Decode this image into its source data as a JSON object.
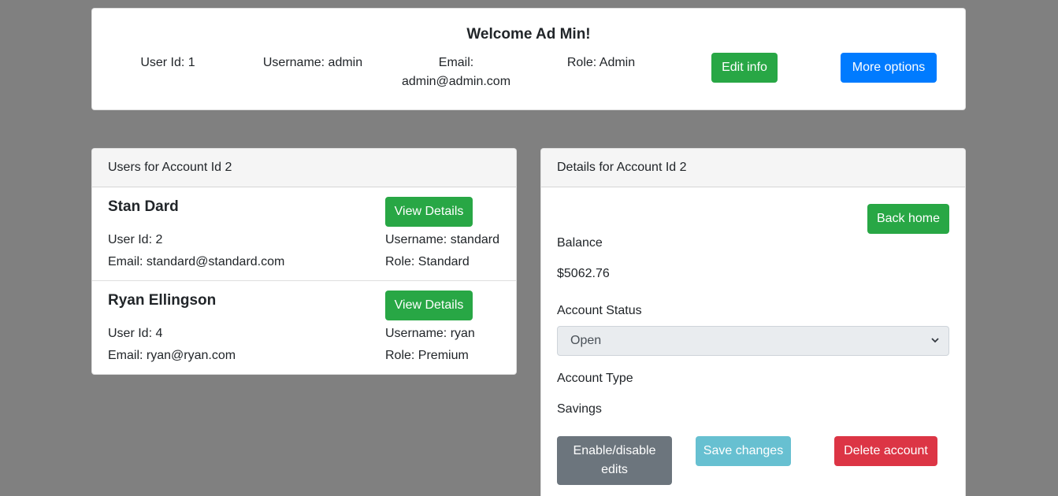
{
  "welcome": {
    "title": "Welcome Ad Min!",
    "user_id": "User Id: 1",
    "username": "Username: admin",
    "email_label": "Email:",
    "email_value": "admin@admin.com",
    "role": "Role: Admin",
    "edit_info_label": "Edit info",
    "more_options_label": "More options"
  },
  "users_panel": {
    "header": "Users for Account Id 2",
    "users": [
      {
        "name": "Stan Dard",
        "view_details_label": "View Details",
        "user_id": "User Id: 2",
        "username": "Username: standard",
        "email": "Email: standard@standard.com",
        "role": "Role: Standard"
      },
      {
        "name": "Ryan Ellingson",
        "view_details_label": "View Details",
        "user_id": "User Id: 4",
        "username": "Username: ryan",
        "email": "Email: ryan@ryan.com",
        "role": "Role: Premium"
      }
    ]
  },
  "details_panel": {
    "header": "Details for Account Id 2",
    "back_home_label": "Back home",
    "balance_label": "Balance",
    "balance_value": "$5062.76",
    "status_label": "Account Status",
    "status_selected": "Open",
    "type_label": "Account Type",
    "type_value": "Savings",
    "enable_disable_line1": "Enable/disable",
    "enable_disable_line2": "edits",
    "save_changes_label": "Save changes",
    "delete_account_label": "Delete account"
  },
  "colors": {
    "background": "#808080",
    "success": "#28a745",
    "primary": "#007bff",
    "secondary": "#6c757d",
    "info": "#67c0d1",
    "danger": "#dc3545"
  },
  "icons": {
    "status_dropdown": "chevron-down-icon"
  }
}
